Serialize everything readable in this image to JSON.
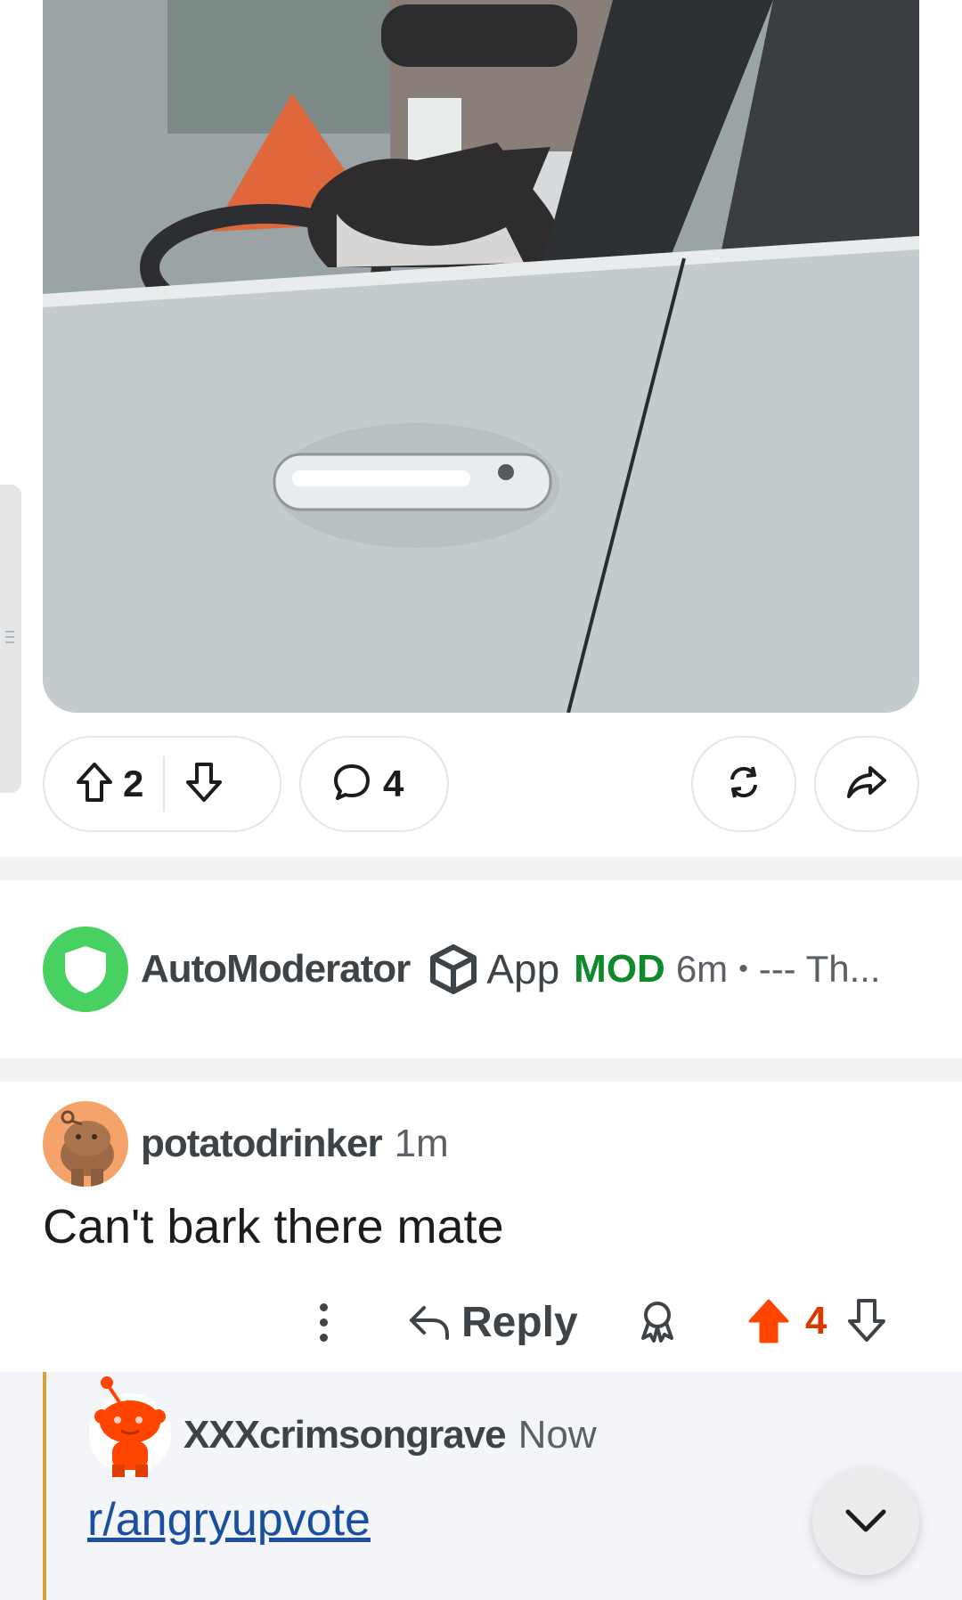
{
  "post": {
    "upvote_count": "2",
    "comment_count": "4",
    "image_alt": "Dog sitting in the driver's seat of a white car"
  },
  "automod": {
    "name": "AutoModerator",
    "app_label": "App",
    "mod_label": "MOD",
    "time": "6m",
    "separator": "•",
    "preview": "--- Th..."
  },
  "comment": {
    "username": "potatodrinker",
    "time": "1m",
    "body": "Can't bark there mate",
    "reply_label": "Reply",
    "score": "4"
  },
  "reply": {
    "username": "XXXcrimsongrave",
    "time": "Now",
    "link_text": "r/angryupvote"
  },
  "colors": {
    "mod_green": "#0e8a2b",
    "upvote_orange": "#ff4500",
    "score_orange": "#d93a00",
    "link_blue": "#1a4fa0",
    "thread_line": "#d4a43a"
  },
  "icons": [
    "upvote-icon",
    "downvote-icon",
    "comment-icon",
    "crosspost-icon",
    "share-icon",
    "shield-icon",
    "app-cube-icon",
    "more-icon",
    "reply-icon",
    "award-icon",
    "upvote-filled-icon",
    "chevron-down-icon"
  ]
}
